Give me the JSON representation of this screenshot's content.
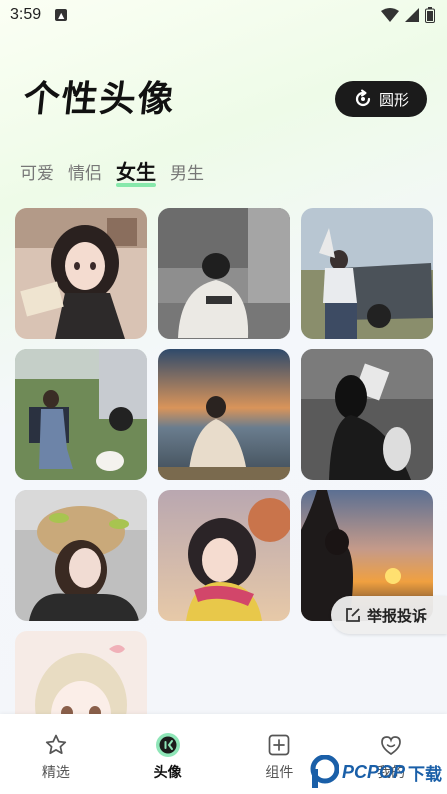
{
  "status": {
    "time": "3:59"
  },
  "header": {
    "title": "个性头像",
    "shape_button": "圆形"
  },
  "tabs": [
    {
      "label": "可爱",
      "active": false
    },
    {
      "label": "情侣",
      "active": false
    },
    {
      "label": "女生",
      "active": true
    },
    {
      "label": "男生",
      "active": false
    }
  ],
  "photos": [
    {
      "name": "anime-girl-reading"
    },
    {
      "name": "girl-on-ground-bw"
    },
    {
      "name": "boy-by-suv"
    },
    {
      "name": "girl-camping-chair-dog"
    },
    {
      "name": "girl-sunset-sea"
    },
    {
      "name": "girl-dark-room-book"
    },
    {
      "name": "girl-fuzzy-hat"
    },
    {
      "name": "anime-girl-scarf"
    },
    {
      "name": "girl-sunset-silhouette"
    },
    {
      "name": "anime-girl-blonde"
    }
  ],
  "report_button": {
    "label": "举报投诉"
  },
  "nav": [
    {
      "label": "精选",
      "icon": "star-icon",
      "active": false
    },
    {
      "label": "头像",
      "icon": "avatar-face-icon",
      "active": true
    },
    {
      "label": "组件",
      "icon": "plus-square-icon",
      "active": false
    },
    {
      "label": "我的",
      "icon": "heart-face-icon",
      "active": false
    }
  ],
  "watermark": {
    "brand": "PCPOP",
    "suffix": "下载"
  },
  "colors": {
    "accent_green": "#7be6a4",
    "dark_button": "#1b1b1b",
    "brand_blue": "#1a5fa8"
  }
}
